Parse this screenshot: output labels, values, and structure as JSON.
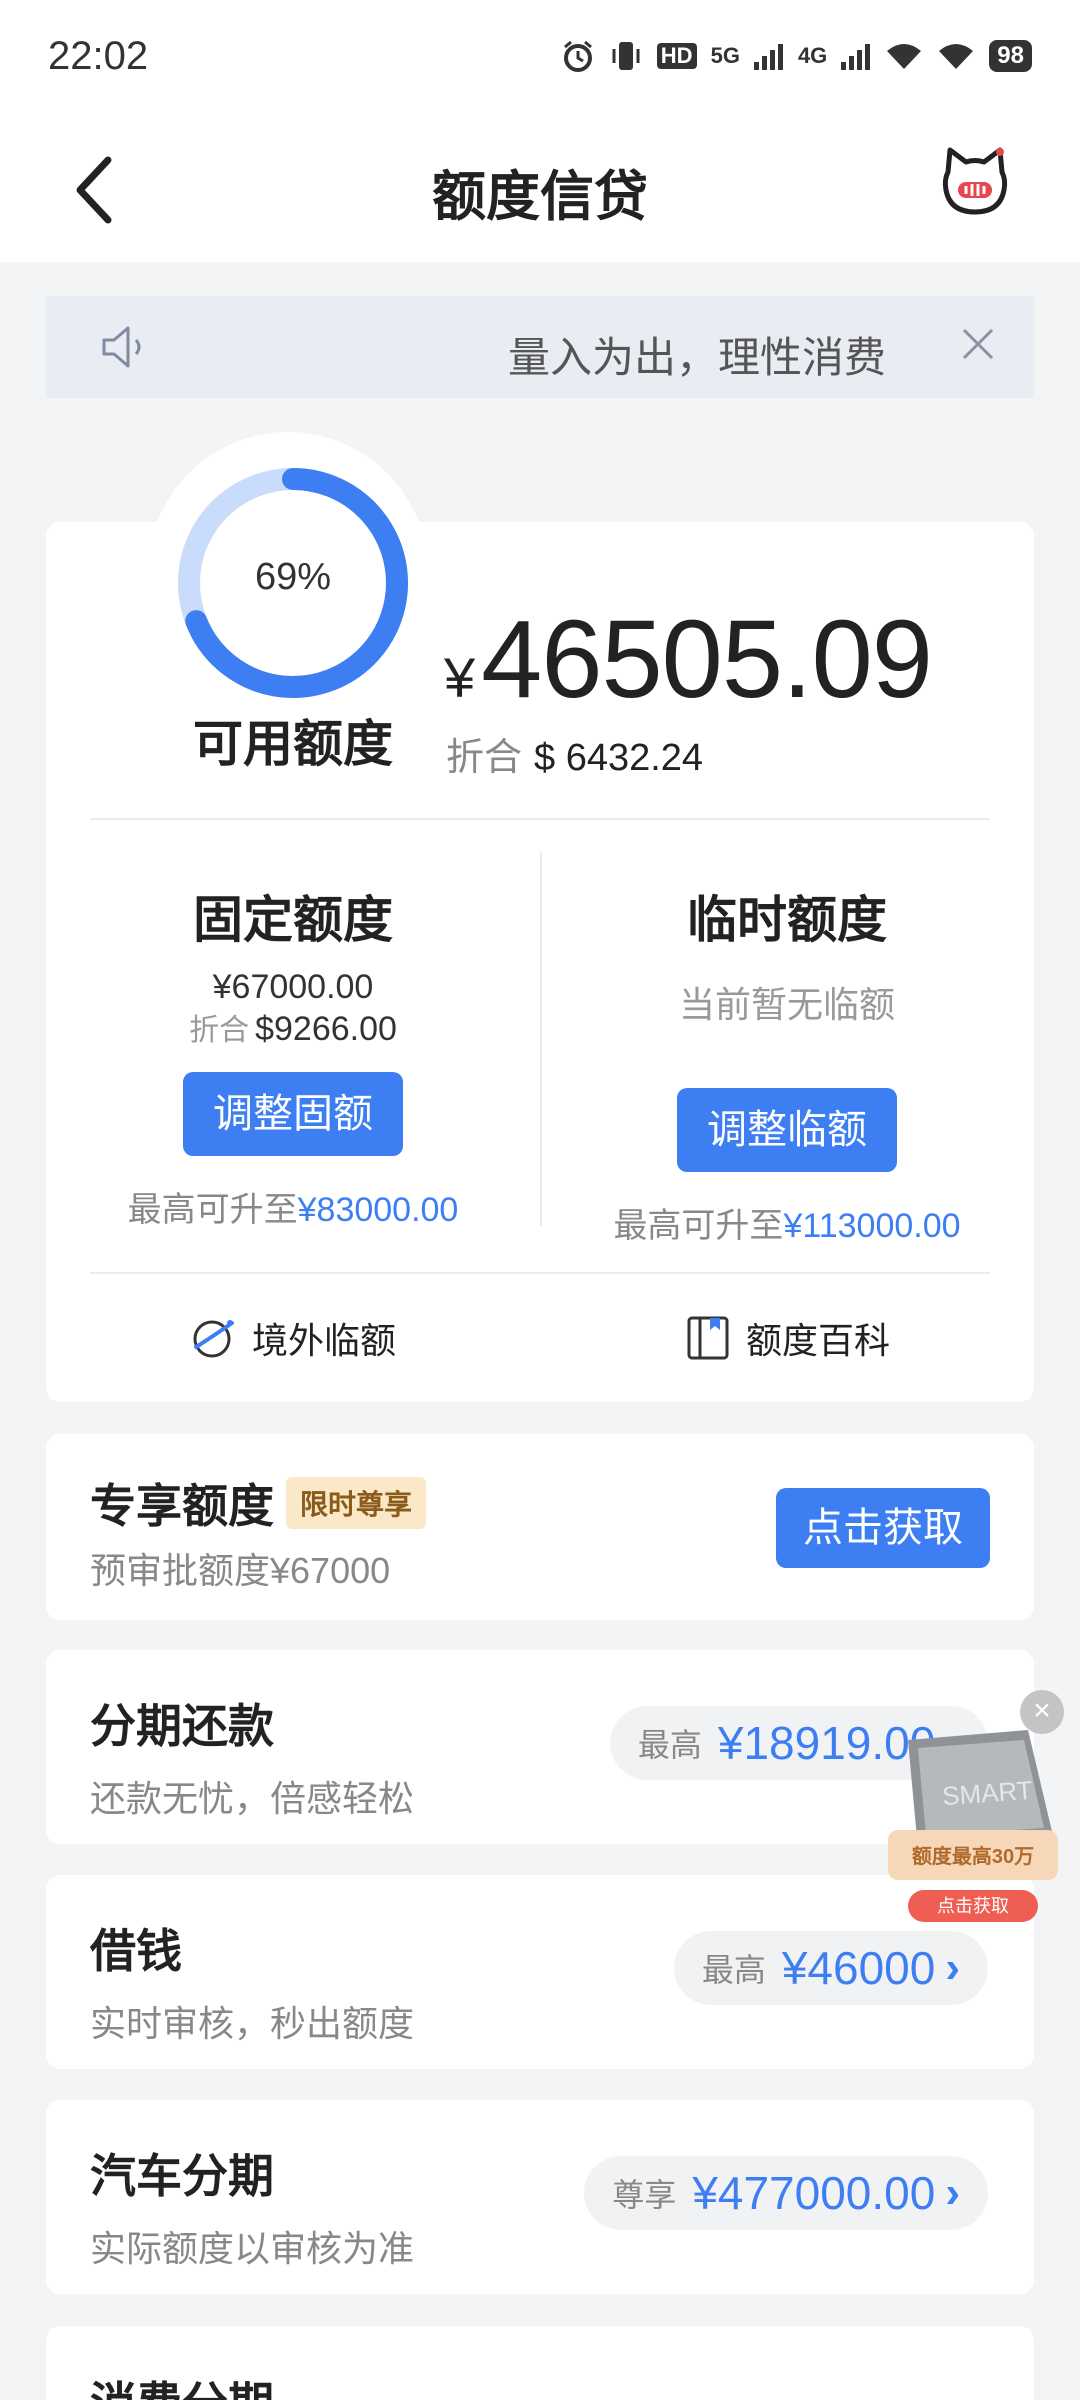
{
  "status_bar": {
    "time": "22:02",
    "network": "5G",
    "network2": "4G",
    "hd": "HD",
    "battery": "98"
  },
  "nav": {
    "title": "额度信贷"
  },
  "notice": {
    "text": "量入为出，理性消费"
  },
  "credit": {
    "ring_percent": "69%",
    "ring_fraction": 0.69,
    "available_label": "可用额度",
    "currency_symbol": "¥",
    "available_amount": "46505.09",
    "fold_label": "折合",
    "fold_amount": "$ 6432.24"
  },
  "fixed": {
    "title": "固定额度",
    "amount": "¥67000.00",
    "fold_label": "折合",
    "fold_amount": "$9266.00",
    "button": "调整固额",
    "max_label": "最高可升至",
    "max_value": "¥83000.00"
  },
  "temp": {
    "title": "临时额度",
    "status": "当前暂无临额",
    "button": "调整临额",
    "max_label": "最高可升至",
    "max_value": "¥113000.00"
  },
  "tools": {
    "overseas": "境外临额",
    "encyclopedia": "额度百科"
  },
  "exclusive": {
    "title": "专享额度",
    "badge": "限时尊享",
    "subtitle": "预审批额度¥67000",
    "button": "点击获取"
  },
  "products": [
    {
      "title": "分期还款",
      "subtitle": "还款无忧，倍感轻松",
      "prefix": "最高",
      "value": "¥18919.00"
    },
    {
      "title": "借钱",
      "subtitle": "实时审核，秒出额度",
      "prefix": "最高",
      "value": "¥46000"
    },
    {
      "title": "汽车分期",
      "subtitle": "实际额度以审核为准",
      "prefix": "尊享",
      "value": "¥477000.00"
    },
    {
      "title": "消费分期"
    }
  ],
  "float_ad": {
    "card_text": "SMART",
    "headline": "额度最高30万",
    "button": "点击获取"
  },
  "colors": {
    "accent": "#3d7ff3",
    "ring_light": "#c9dcfb",
    "badge_bg": "#fbe8c8"
  }
}
